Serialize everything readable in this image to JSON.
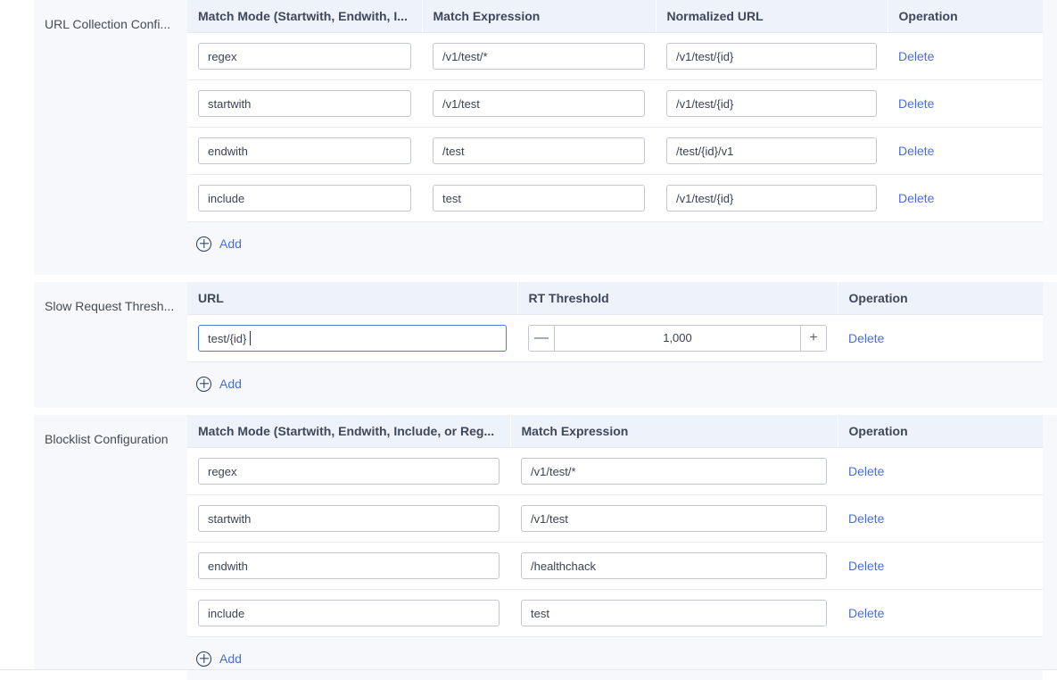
{
  "sections": [
    {
      "id": "url-collection-config",
      "label": "URL Collection Confi...",
      "columns": [
        "Match Mode (Startwith, Endwith, I...",
        "Match Expression",
        "Normalized URL",
        "Operation"
      ],
      "rows": [
        {
          "mode": "regex",
          "expression": "/v1/test/*",
          "normalized": "/v1/test/{id}",
          "action": "Delete"
        },
        {
          "mode": "startwith",
          "expression": "/v1/test",
          "normalized": "/v1/test/{id}",
          "action": "Delete"
        },
        {
          "mode": "endwith",
          "expression": "/test",
          "normalized": "/test/{id}/v1",
          "action": "Delete"
        },
        {
          "mode": "include",
          "expression": "test",
          "normalized": "/v1/test/{id}",
          "action": "Delete"
        }
      ],
      "add_label": "Add"
    },
    {
      "id": "slow-request-threshold",
      "label": "Slow Request Thresh...",
      "columns": [
        "URL",
        "RT Threshold",
        "Operation"
      ],
      "rows": [
        {
          "url": "test/{id}",
          "rt_threshold": "1,000",
          "action": "Delete",
          "focused": true
        }
      ],
      "stepper": {
        "decrement_label": "—",
        "increment_label": "+"
      },
      "add_label": "Add"
    },
    {
      "id": "blocklist-configuration",
      "label": "Blocklist Configuration",
      "columns": [
        "Match Mode (Startwith, Endwith, Include, or Reg...",
        "Match Expression",
        "Operation"
      ],
      "rows": [
        {
          "mode": "regex",
          "expression": "/v1/test/*",
          "action": "Delete"
        },
        {
          "mode": "startwith",
          "expression": "/v1/test",
          "action": "Delete"
        },
        {
          "mode": "endwith",
          "expression": "/healthchack",
          "action": "Delete"
        },
        {
          "mode": "include",
          "expression": "test",
          "action": "Delete"
        }
      ],
      "add_label": "Add"
    }
  ],
  "colors": {
    "panel_background": "#f6f8fc",
    "table_header_background": "#eef2fa",
    "link": "#4a6fd4",
    "focus_border": "#4a7dd6",
    "input_border": "#c3c6cd",
    "text": "#3b4252"
  }
}
